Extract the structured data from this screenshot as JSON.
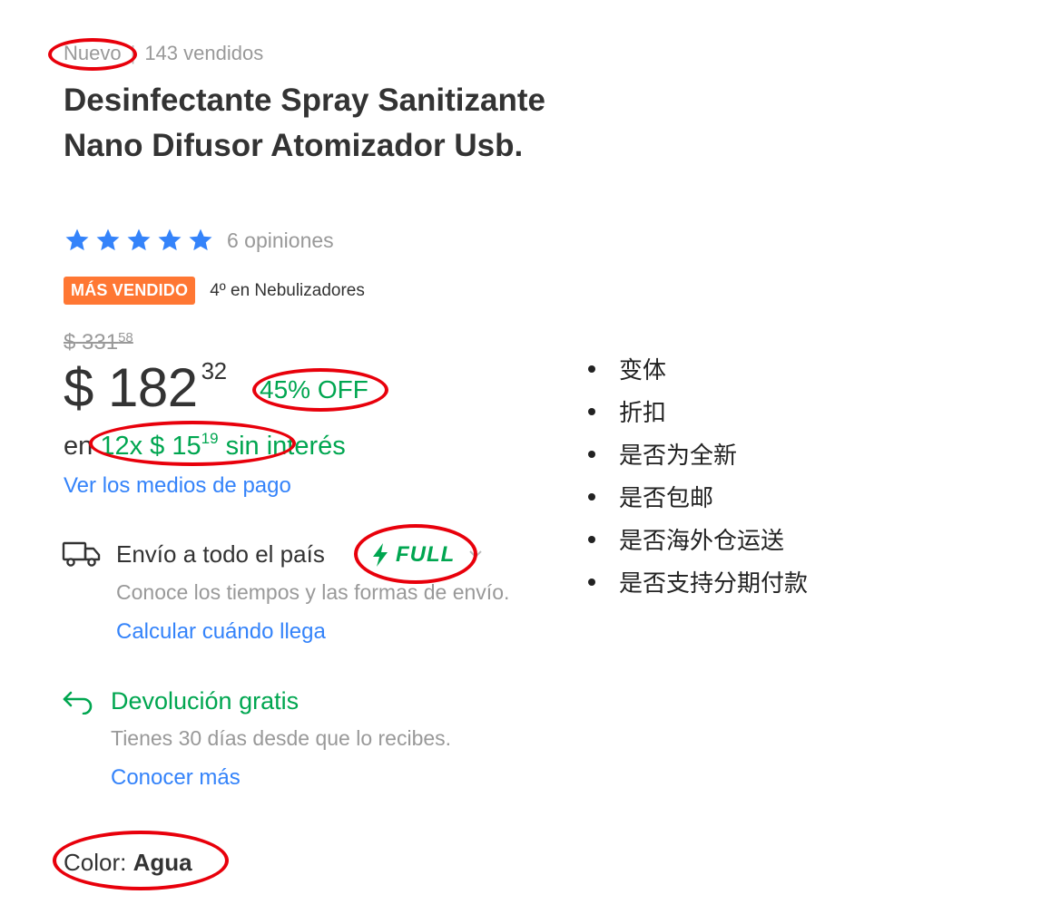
{
  "header": {
    "condition": "Nuevo",
    "separator": "|",
    "sold": "143 vendidos",
    "title": "Desinfectante Spray Sanitizante Nano Difusor Atomizador Usb."
  },
  "rating": {
    "stars": 5,
    "stars_max": 5,
    "reviews": "6 opiniones",
    "star_color": "#3483fa"
  },
  "badge": {
    "label": "MÁS VENDIDO",
    "rank": "4º en Nebulizadores",
    "color": "#ff7733"
  },
  "price": {
    "old_currency": "$",
    "old_integer": "331",
    "old_cents": "58",
    "currency": "$",
    "integer": "182",
    "cents": "32",
    "discount": "45% OFF"
  },
  "installments": {
    "prefix": "en",
    "count": "12x",
    "currency": "$",
    "integer": "15",
    "cents": "19",
    "suffix": "sin interés",
    "payment_link": "Ver los medios de pago"
  },
  "shipping": {
    "icon": "truck-icon",
    "title": "Envío a todo el país",
    "full_label": "FULL",
    "subtitle": "Conoce los tiempos y las formas de envío.",
    "link": "Calcular cuándo llega"
  },
  "returns": {
    "icon": "return-arrow-icon",
    "title": "Devolución gratis",
    "subtitle": "Tienes 30 días desde que lo recibes.",
    "link": "Conocer más"
  },
  "variant": {
    "label": "Color:",
    "value": "Agua"
  },
  "annotations": {
    "bullets": [
      "变体",
      "折扣",
      "是否为全新",
      "是否包邮",
      "是否海外仓运送",
      "是否支持分期付款"
    ],
    "ring_color": "#e8000b"
  },
  "colors": {
    "green": "#00a650",
    "link_blue": "#3483fa",
    "muted": "#999999"
  }
}
